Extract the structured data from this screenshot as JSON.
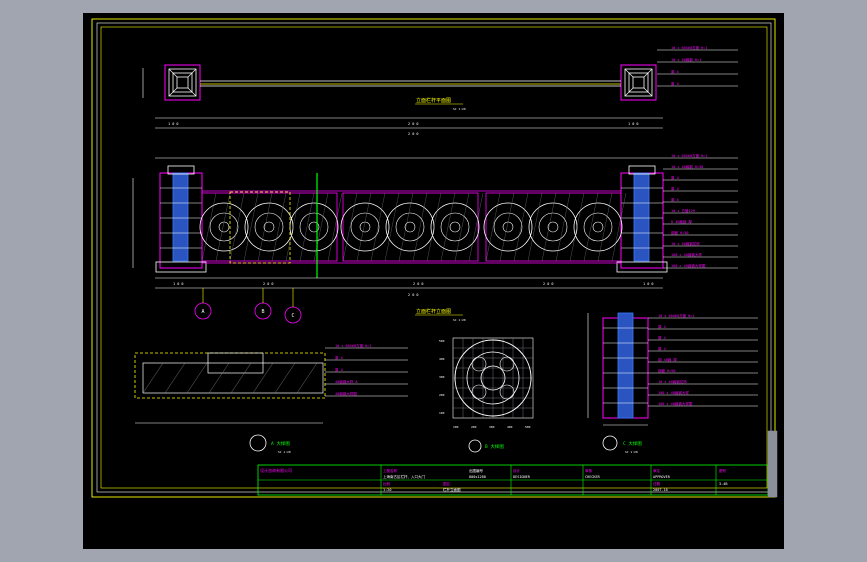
{
  "colors": {
    "background": "#000000",
    "workspace": "#a1a5af",
    "frame": "#ffff00",
    "magenta": "#ff00ff",
    "cyan": "#00ffff",
    "white": "#ffffff",
    "green": "#00ff00",
    "blue": "#3a78ff",
    "grey": "#8a8f9a"
  },
  "titles": {
    "plan": "立面栏杆平面图",
    "plan_scale": "SC 1:20",
    "elevation": "立面栏杆立面图",
    "elevation_scale": "SC 1:20",
    "section_a": "A 大样图",
    "section_a_scale": "SC 1:20",
    "detail_b": "B 大样图",
    "section_c": "C 大样图",
    "section_c_scale": "SC 1:20"
  },
  "annotations_plan": [
    "10 x 60X60方管 H=1",
    "10 x 40扁钢 H=1",
    "厚 4",
    "厚 4"
  ],
  "annotations_elev": [
    "10 x 60X60方管 H=1",
    "10 x 40扁钢 H=50",
    "厚 4",
    "厚 4",
    "厚 4",
    "10 x 方管12H",
    "D 40扁钢 厚",
    "钢管 H=50",
    "10 x 40扁钢花饰",
    "100 x 40扁钢大样",
    "100 x 40扁钢大样图"
  ],
  "annotations_a": [
    "10 x 60X60方管 H=1",
    "厚 4",
    "厚 4",
    "40扁钢大样 A",
    "40扁钢大样图"
  ],
  "annotations_c": [
    "10 x 60X60方管 H=1",
    "厚 4",
    "厚 4",
    "厚 4",
    "钢 40扁 厚",
    "钢管 H=50",
    "10 x 40扁钢花饰",
    "100 x 40扁钢大样",
    "100 x 40扁钢大样图"
  ],
  "dims": {
    "plan_total": "2 0 0",
    "plan_parts": [
      "1 0 0",
      "2 0 0",
      "1 0 0"
    ],
    "elev_total": "2 0 0",
    "elev_parts": [
      "1 0 0",
      "2 0 0",
      "2 0 0",
      "2 0 0",
      "1 0 0"
    ],
    "b_axis": [
      "100",
      "200",
      "300",
      "400",
      "500"
    ],
    "b_axis_v": [
      "500",
      "400",
      "300",
      "200",
      "100"
    ]
  },
  "callouts": [
    "A",
    "B",
    "C"
  ],
  "title_block": {
    "company": "设计咨询有限公司",
    "project_label": "工程名称",
    "project": "上海南古区栏杆、入口大门",
    "drawing_label": "图名",
    "drawing": "栏杆立面图",
    "scale_label": "比例",
    "scale": "1:20",
    "number_label": "出图编号",
    "number": "800x1280",
    "design_label": "设计",
    "design": "DESIGNER",
    "check_label": "审核",
    "check": "CHECKER",
    "approve_label": "审定",
    "approve": "APPROVER",
    "date_label": "日期",
    "date": "2007.10",
    "sheet_label": "图号",
    "sheet": "3-4B"
  }
}
